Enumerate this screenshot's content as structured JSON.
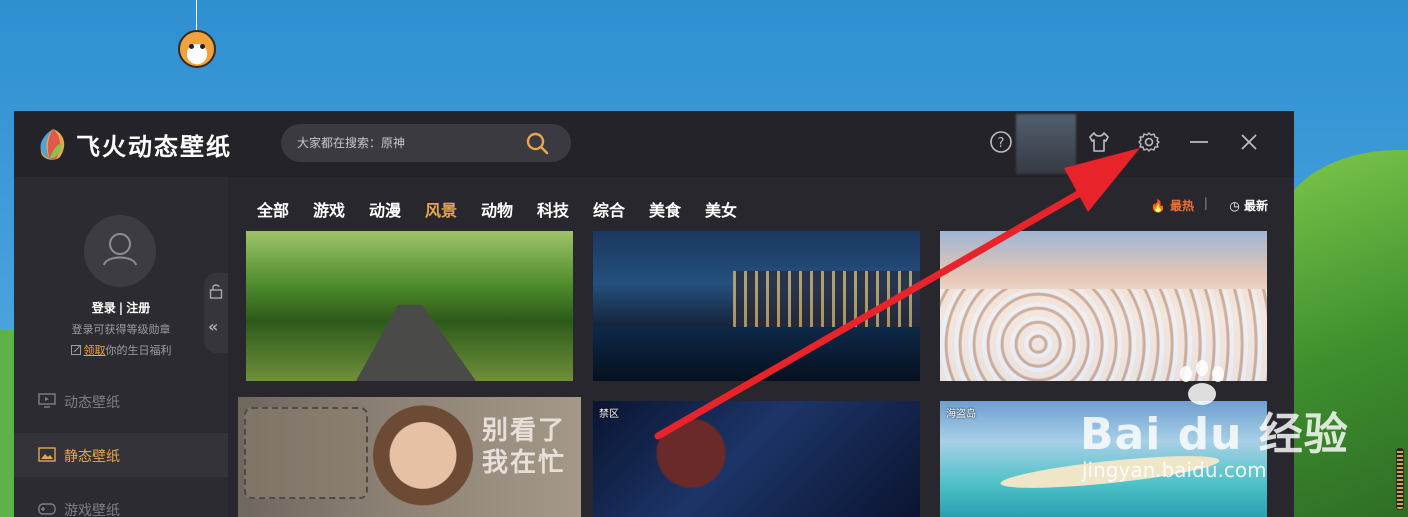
{
  "app": {
    "title": "飞火动态壁纸",
    "accent": "#e8a64c"
  },
  "search": {
    "placeholder": "大家都在搜索：原神",
    "icon": "search-icon"
  },
  "titlebar": {
    "icons": [
      "help-icon",
      "skin-shirt-icon",
      "settings-gear-icon",
      "minimize-icon",
      "close-icon"
    ]
  },
  "user": {
    "login": "登录",
    "separator": "|",
    "register": "注册",
    "hint": "登录可获得等级勋章",
    "gift_claim": "领取",
    "gift_rest": "你的生日福利"
  },
  "nav": {
    "items": [
      {
        "label": "动态壁纸",
        "icon": "monitor-icon",
        "active": false
      },
      {
        "label": "静态壁纸",
        "icon": "image-icon",
        "active": true
      },
      {
        "label": "游戏壁纸",
        "icon": "gamepad-icon",
        "active": false
      }
    ]
  },
  "categories": {
    "items": [
      "全部",
      "游戏",
      "动漫",
      "风景",
      "动物",
      "科技",
      "综合",
      "美食",
      "美女"
    ],
    "active": "风景"
  },
  "sort": {
    "hot": "最热",
    "separator": "|",
    "new": "最新"
  },
  "thumbs": {
    "t5_tag": "禁区",
    "t6_tag": "海盗岛",
    "t4_text_line1": "别看了",
    "t4_text_line2": "我在忙"
  },
  "watermark": {
    "main": "Bai du 经验",
    "sub": "jingyan.baidu.com"
  }
}
